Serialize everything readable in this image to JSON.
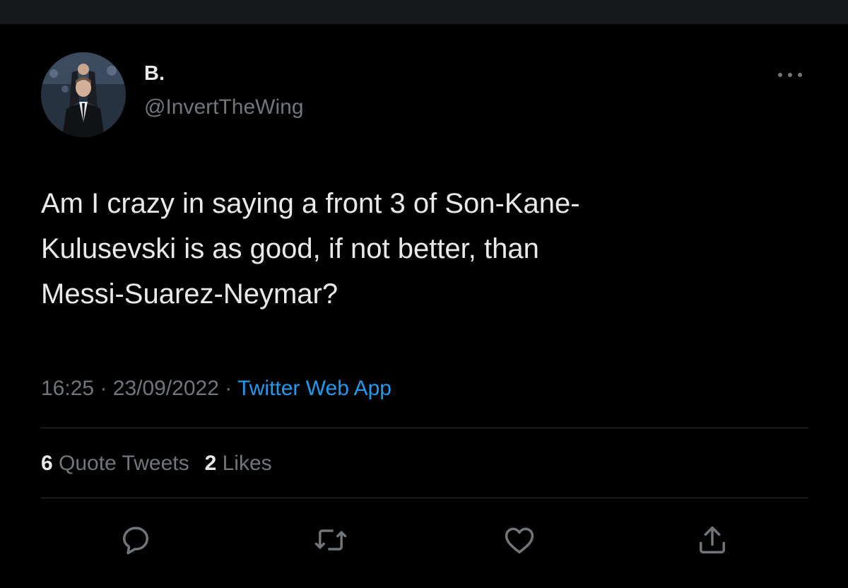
{
  "tweet": {
    "author": {
      "display_name": "B.",
      "handle": "@InvertTheWing"
    },
    "text_lines": [
      "Am I crazy in saying a front 3 of Son-Kane-",
      "Kulusevski is as good, if not better, than",
      "Messi-Suarez-Neymar?"
    ],
    "time": "16:25",
    "date": "23/09/2022",
    "separator": "·",
    "source": "Twitter Web App",
    "stats": {
      "quote_tweets_count": "6",
      "quote_tweets_label": "Quote Tweets",
      "likes_count": "2",
      "likes_label": "Likes"
    }
  },
  "icons": {
    "more": "more-horizontal-icon",
    "reply": "reply-bubble-icon",
    "retweet": "retweet-icon",
    "like": "heart-icon",
    "share": "share-icon"
  },
  "colors": {
    "background": "#000000",
    "primary_text": "#e7e9ea",
    "secondary_text": "#71767b",
    "link": "#1d9bf0",
    "divider": "#2f3336"
  }
}
